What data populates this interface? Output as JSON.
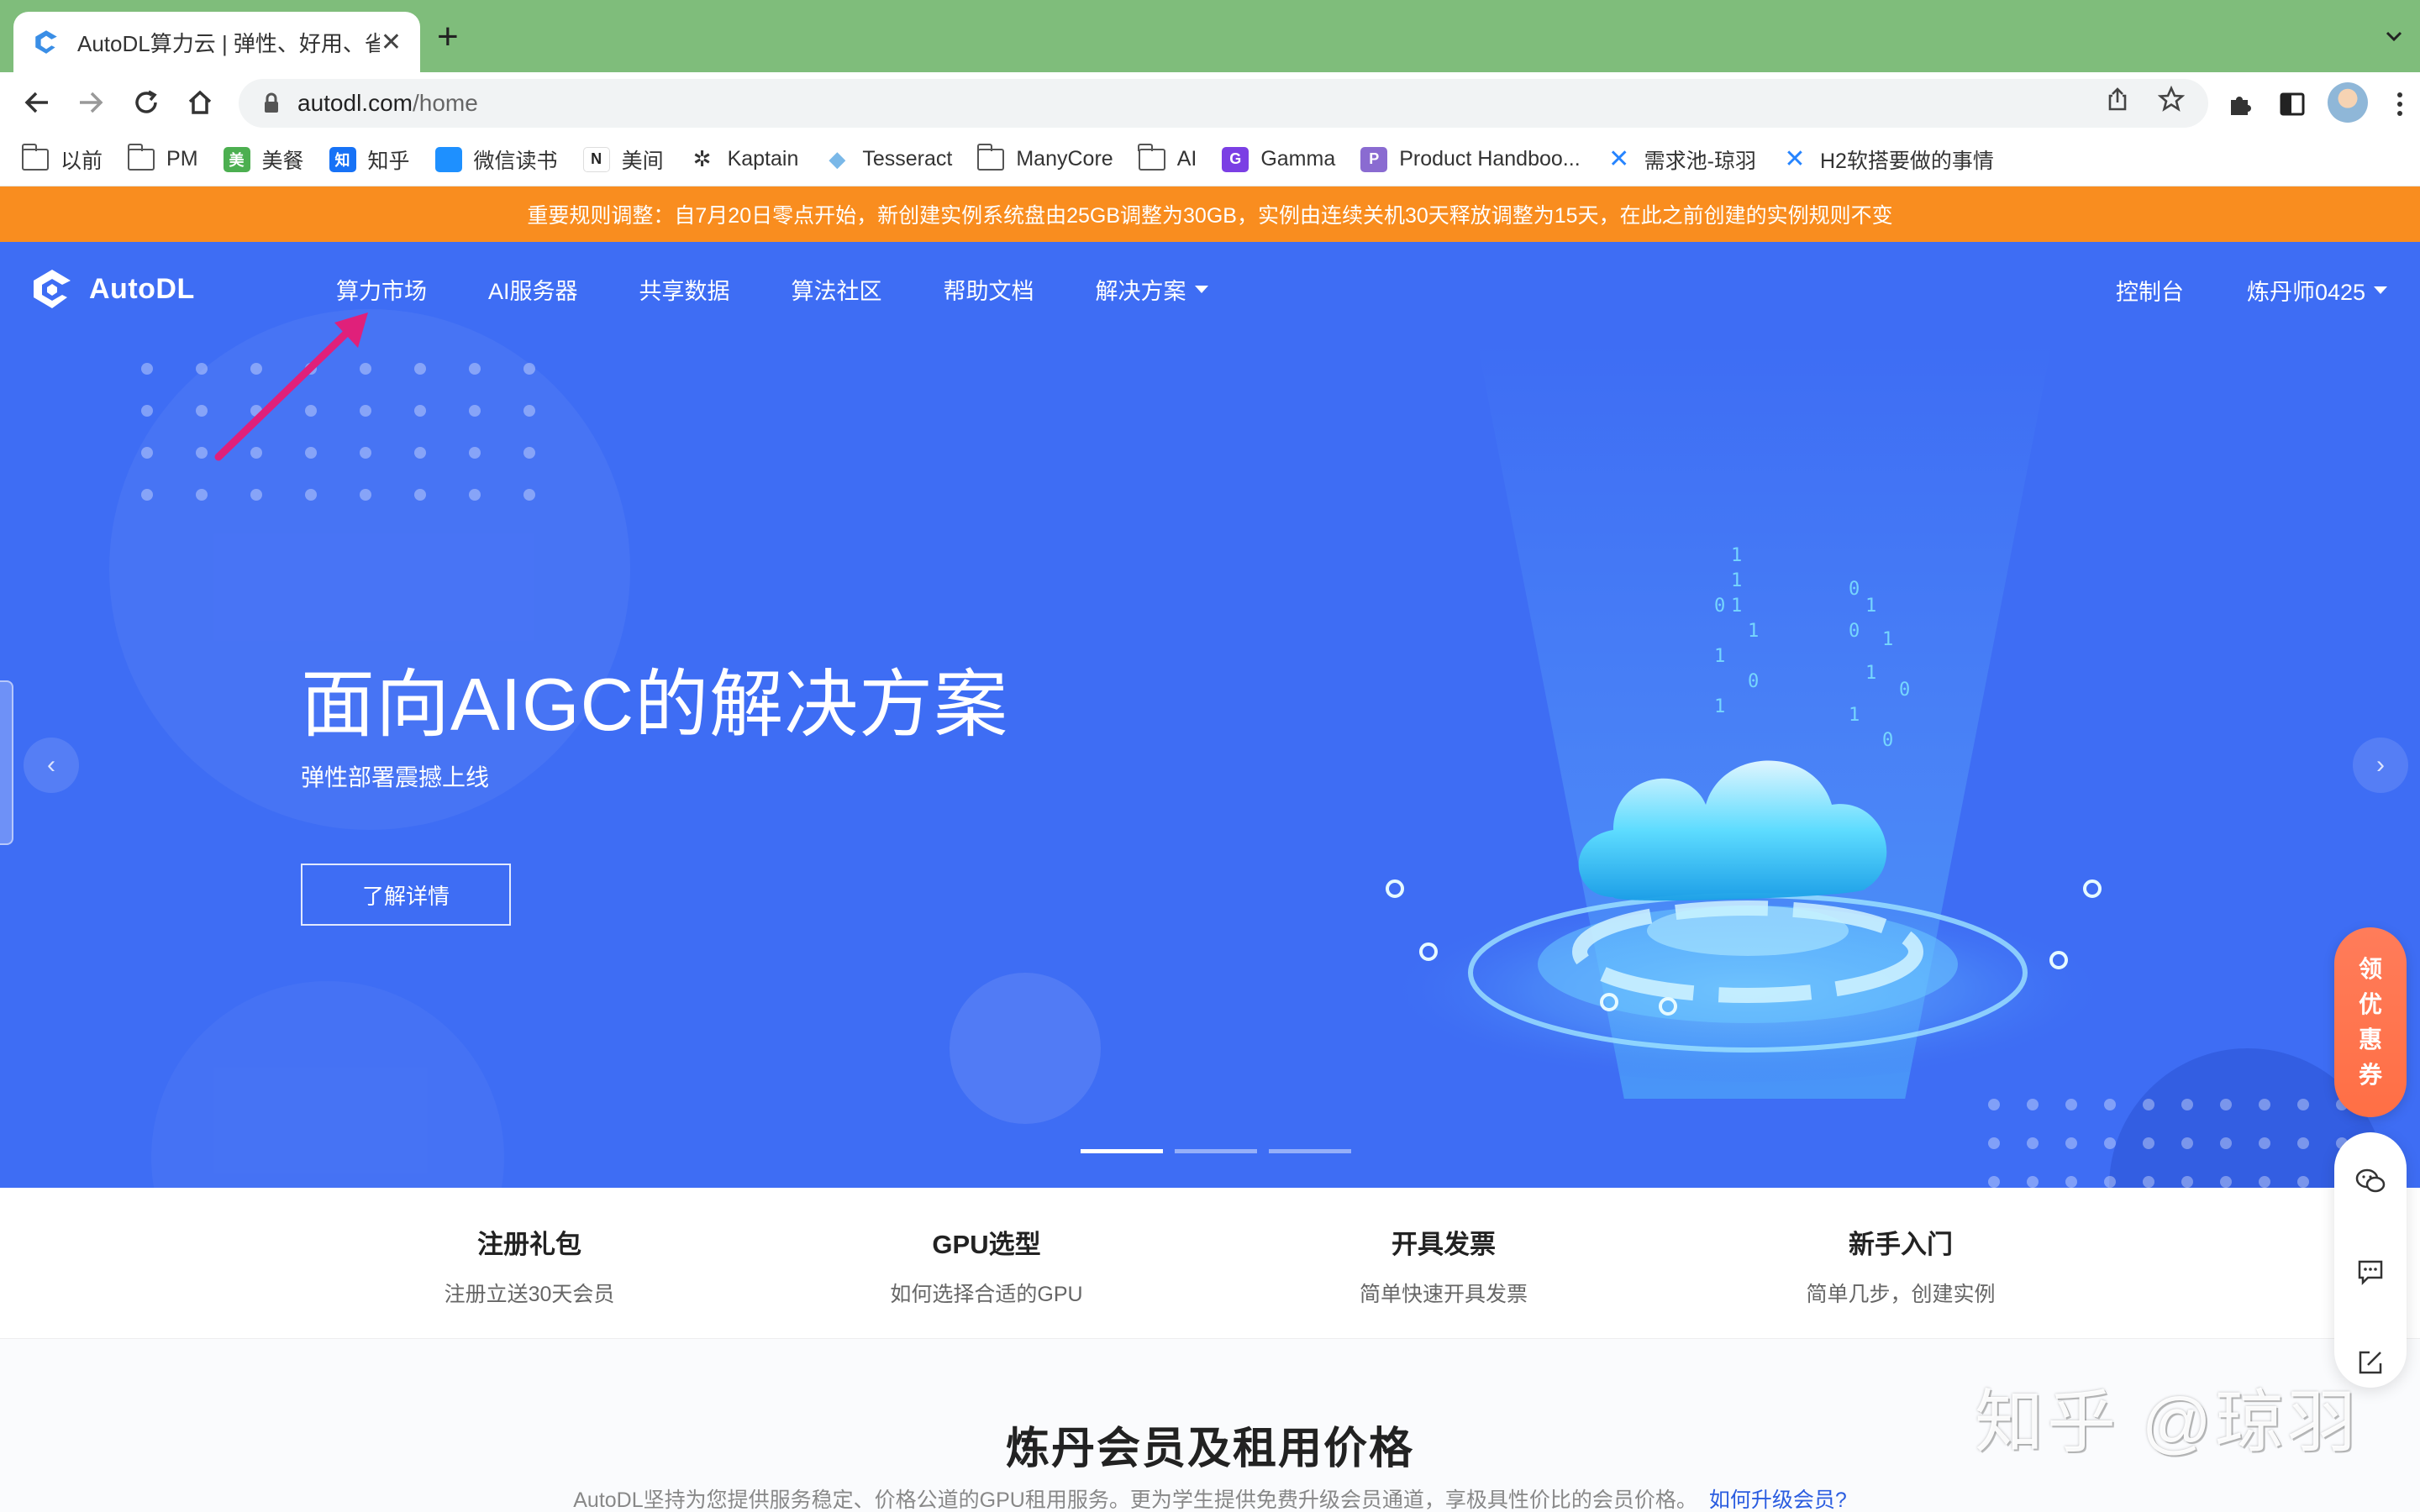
{
  "browser": {
    "tab_title": "AutoDL算力云 | 弹性、好用、省钱",
    "url_host": "autodl.com",
    "url_path": "/home",
    "bookmarks": [
      {
        "label": "以前",
        "icon": "folder-icon"
      },
      {
        "label": "PM",
        "icon": "folder-icon"
      },
      {
        "label": "美餐",
        "icon": "meican-icon",
        "color": "#4caf50"
      },
      {
        "label": "知乎",
        "icon": "zhihu-icon",
        "color": "#1772f6"
      },
      {
        "label": "微信读书",
        "icon": "weread-icon",
        "color": "#1e90ff"
      },
      {
        "label": "美间",
        "icon": "meijian-icon",
        "color": "#222222"
      },
      {
        "label": "Kaptain",
        "icon": "kaptain-icon",
        "color": "#333333"
      },
      {
        "label": "Tesseract",
        "icon": "tesseract-icon",
        "color": "#7ab8e8"
      },
      {
        "label": "ManyCore",
        "icon": "folder-icon"
      },
      {
        "label": "AI",
        "icon": "folder-icon"
      },
      {
        "label": "Gamma",
        "icon": "gamma-icon",
        "color": "#7b3fe4"
      },
      {
        "label": "Product Handboo...",
        "icon": "notion-icon",
        "color": "#8a6bd1"
      },
      {
        "label": "需求池-琼羽",
        "icon": "confluence-icon",
        "color": "#2684ff"
      },
      {
        "label": "H2软搭要做的事情",
        "icon": "confluence-icon",
        "color": "#2684ff"
      }
    ]
  },
  "notice": {
    "text": "重要规则调整：自7月20日零点开始，新创建实例系统盘由25GB调整为30GB，实例由连续关机30天释放调整为15天，在此之前创建的实例规则不变",
    "color": "#f98d1f"
  },
  "site": {
    "logo_text": "AutoDL",
    "nav": [
      {
        "label": "算力市场"
      },
      {
        "label": "AI服务器"
      },
      {
        "label": "共享数据"
      },
      {
        "label": "算法社区"
      },
      {
        "label": "帮助文档"
      },
      {
        "label": "解决方案",
        "dropdown": true
      }
    ],
    "console_label": "控制台",
    "user_name": "炼丹师0425",
    "brand_color": "#3e6df4"
  },
  "hero": {
    "title": "面向AIGC的解决方案",
    "subtitle": "弹性部署震撼上线",
    "button_label": "了解详情",
    "prev_arrow": "‹",
    "next_arrow": "›",
    "slides_count": 3,
    "active_slide": 1
  },
  "features": [
    {
      "title": "注册礼包",
      "desc": "注册立送30天会员"
    },
    {
      "title": "GPU选型",
      "desc": "如何选择合适的GPU"
    },
    {
      "title": "开具发票",
      "desc": "简单快速开具发票"
    },
    {
      "title": "新手入门",
      "desc": "简单几步，创建实例"
    }
  ],
  "pricing": {
    "title": "炼丹会员及租用价格",
    "desc": "AutoDL坚持为您提供服务稳定、价格公道的GPU租用服务。更为学生提供免费升级会员通道，享极具性价比的会员价格。",
    "link_label": "如何升级会员?"
  },
  "widgets": {
    "coupon_chars": [
      "领",
      "优",
      "惠",
      "券"
    ]
  },
  "watermark": "知乎 @琼羽"
}
